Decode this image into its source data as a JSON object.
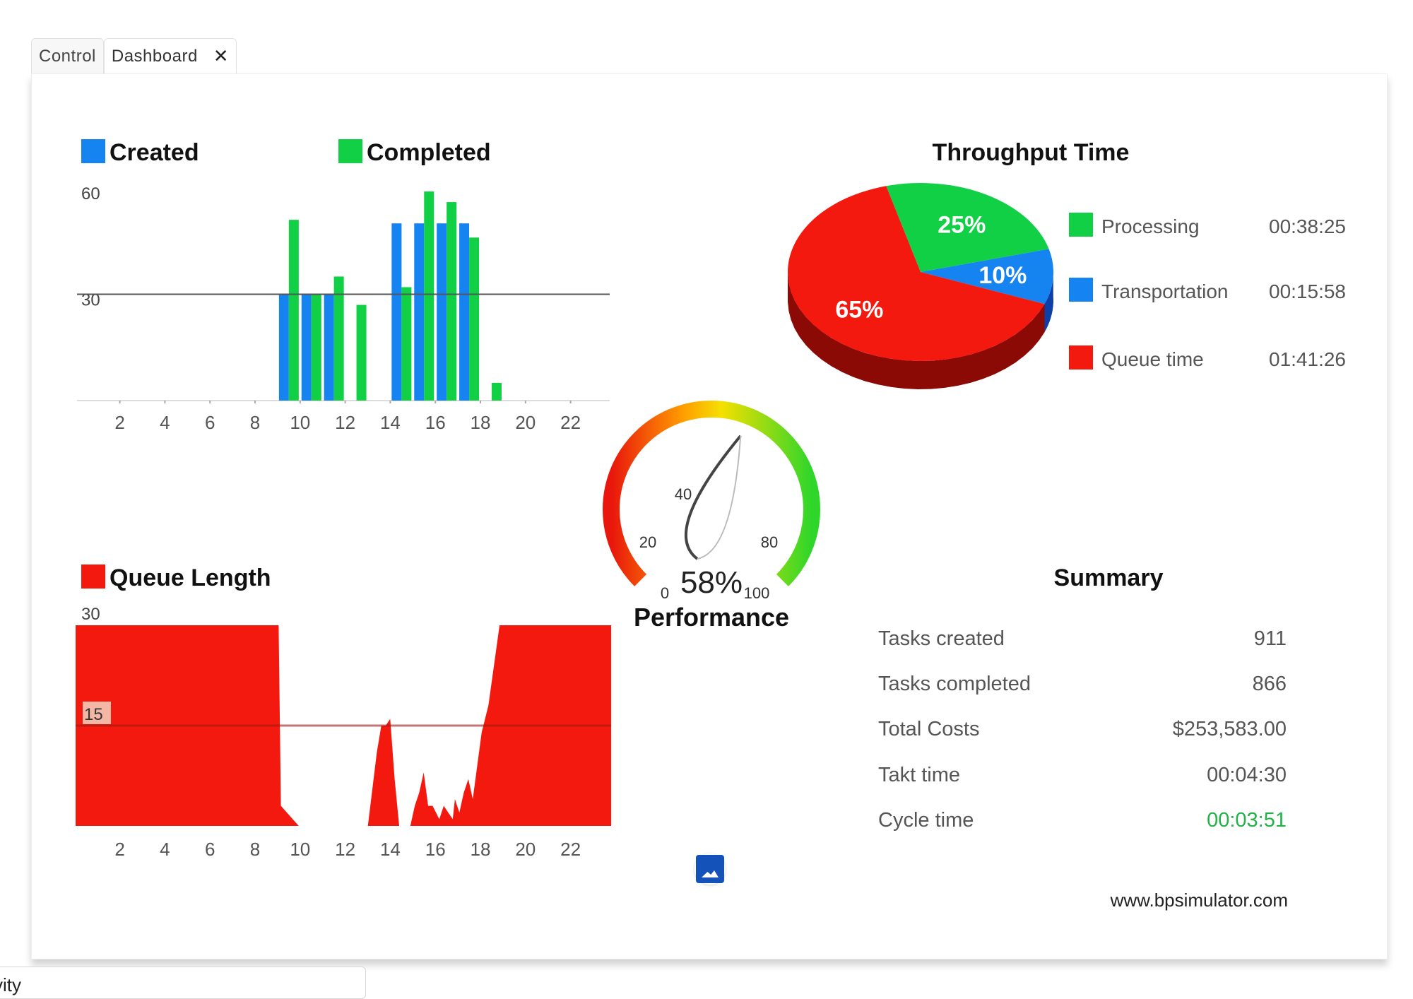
{
  "tabs": [
    {
      "label": "Control"
    },
    {
      "label": "Dashboard"
    }
  ],
  "bottom_tab": {
    "label": "vity"
  },
  "footer": {
    "url": "www.bpsimulator.com"
  },
  "colors": {
    "created": "#1584f0",
    "completed": "#12d046",
    "queue": "#f3190f",
    "accent_green": "#23b24a",
    "gridline": "#555555"
  },
  "summary": {
    "title": "Summary",
    "rows": [
      {
        "label": "Tasks created",
        "value": "911"
      },
      {
        "label": "Tasks completed",
        "value": "866"
      },
      {
        "label": "Total Costs",
        "value": "$253,583.00"
      },
      {
        "label": "Takt time",
        "value": "00:04:30"
      },
      {
        "label": "Cycle time",
        "value": "00:03:51"
      }
    ]
  },
  "chart_data": [
    {
      "type": "bar",
      "legend": [
        "Created",
        "Completed"
      ],
      "x": [
        1,
        2,
        3,
        4,
        5,
        6,
        7,
        8,
        9,
        10,
        11,
        12,
        13,
        14,
        15,
        16,
        17,
        18,
        19,
        20,
        21,
        22,
        23
      ],
      "x_ticks": [
        2,
        4,
        6,
        8,
        10,
        12,
        14,
        16,
        18,
        20,
        22
      ],
      "y_ticks": [
        30,
        60
      ],
      "ylim": [
        0,
        60
      ],
      "reference_line": 30,
      "series": [
        {
          "name": "Created",
          "values": [
            0,
            0,
            0,
            0,
            0,
            0,
            0,
            0,
            0,
            30,
            30,
            30,
            0,
            0,
            50,
            50,
            50,
            50,
            0,
            0,
            0,
            0,
            0
          ]
        },
        {
          "name": "Completed",
          "values": [
            0,
            0,
            0,
            0,
            0,
            0,
            0,
            0,
            0,
            51,
            30,
            35,
            27,
            0,
            32,
            59,
            56,
            46,
            5,
            0,
            0,
            0,
            0
          ]
        }
      ]
    },
    {
      "type": "pie",
      "title": "Throughput Time",
      "slices": [
        {
          "label": "Processing",
          "time": "00:38:25",
          "percent": 25
        },
        {
          "label": "Transportation",
          "time": "00:15:58",
          "percent": 10
        },
        {
          "label": "Queue time",
          "time": "01:41:26",
          "percent": 65
        }
      ]
    },
    {
      "type": "gauge",
      "title": "Performance",
      "value": 58,
      "display": "58%",
      "scale_labels": [
        "0",
        "20",
        "40",
        "80",
        "100"
      ]
    },
    {
      "type": "area",
      "legend": [
        "Queue Length"
      ],
      "x_ticks": [
        2,
        4,
        6,
        8,
        10,
        12,
        14,
        16,
        18,
        20,
        22
      ],
      "y_ticks": [
        15,
        30
      ],
      "ylim": [
        0,
        30
      ],
      "reference_line": 15,
      "x": [
        0,
        9,
        9.1,
        9.2,
        10,
        11,
        12,
        13,
        13.1,
        13.5,
        13.7,
        13.9,
        14.1,
        14.3,
        14.5,
        15,
        15.2,
        15.4,
        15.6,
        15.8,
        16,
        16.3,
        16.5,
        16.7,
        16.9,
        17,
        17.2,
        17.4,
        17.6,
        17.8,
        18,
        18.2,
        18.5,
        19,
        24
      ],
      "values": [
        30,
        30,
        30,
        3,
        0,
        0,
        0,
        0,
        0,
        11,
        15,
        15,
        16,
        7,
        0,
        0,
        3,
        5,
        8,
        3,
        3,
        1,
        3,
        2,
        1,
        4,
        2,
        5,
        7,
        4,
        9,
        14,
        18,
        30,
        30
      ]
    }
  ]
}
